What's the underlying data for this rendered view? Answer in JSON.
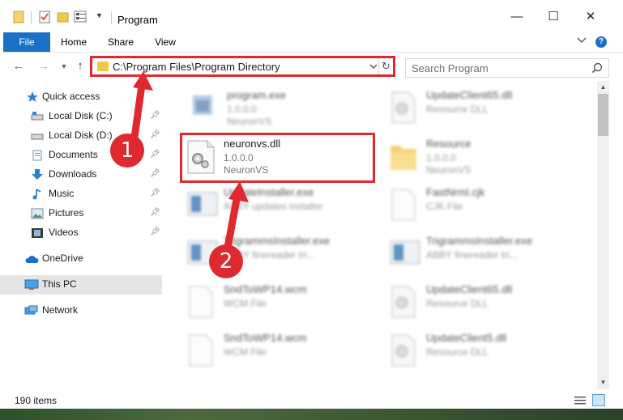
{
  "window": {
    "title": "Program",
    "controls": {
      "minimize": "—",
      "maximize": "☐",
      "close": "✕"
    }
  },
  "ribbon": {
    "tabs": [
      "File",
      "Home",
      "Share",
      "View"
    ],
    "expand_icon": "chevron-down-icon",
    "help": "?"
  },
  "address_bar": {
    "path": "C:\\Program Files\\Program Directory",
    "refresh_icon": "↻"
  },
  "search": {
    "placeholder": "Search Program"
  },
  "sidebar": {
    "items": [
      {
        "label": "Quick access",
        "icon": "star-icon"
      },
      {
        "label": "Local Disk (C:)",
        "icon": "drive-icon",
        "pinned": true
      },
      {
        "label": "Local Disk (D:)",
        "icon": "drive-icon",
        "pinned": true
      },
      {
        "label": "Documents",
        "icon": "documents-icon",
        "pinned": true
      },
      {
        "label": "Downloads",
        "icon": "download-icon",
        "pinned": true
      },
      {
        "label": "Music",
        "icon": "music-icon",
        "pinned": true
      },
      {
        "label": "Pictures",
        "icon": "pictures-icon",
        "pinned": true
      },
      {
        "label": "Videos",
        "icon": "videos-icon",
        "pinned": true
      },
      {
        "label": "OneDrive",
        "icon": "cloud-icon"
      },
      {
        "label": "This PC",
        "icon": "computer-icon",
        "selected": true
      },
      {
        "label": "Network",
        "icon": "network-icon"
      }
    ]
  },
  "files": [
    {
      "name": "program.exe",
      "line2": "1.0.0.0",
      "line3": "NeuronVS",
      "icon": "exe-icon",
      "blurred": true
    },
    {
      "name": "UpdateClient65.dll",
      "line2": "Resource DLL",
      "line3": "",
      "icon": "dll-icon",
      "blurred": true
    },
    {
      "name": "neuronvs.dll",
      "line2": "1.0.0.0",
      "line3": "NeuronVS",
      "icon": "dll-gear-icon",
      "blurred": false
    },
    {
      "name": "Resource",
      "line2": "1.0.0.0",
      "line3": "NeuronVS",
      "icon": "folder-icon",
      "blurred": true
    },
    {
      "name": "UpdateInstaller.exe",
      "line2": "ABBY updates installer",
      "line3": "",
      "icon": "installer-icon",
      "blurred": true
    },
    {
      "name": "FastNrml.cjk",
      "line2": "CJK File",
      "line3": "",
      "icon": "file-icon",
      "blurred": true
    },
    {
      "name": "TrigrammsInstaller.exe",
      "line2": "ABBY finereader tri...",
      "line3": "",
      "icon": "installer-icon",
      "blurred": true
    },
    {
      "name": "TrigrammsInstaller.exe",
      "line2": "ABBY finereader tri...",
      "line3": "",
      "icon": "installer-icon",
      "blurred": true
    },
    {
      "name": "SndToWP14.wcm",
      "line2": "WCM File",
      "line3": "",
      "icon": "file-icon",
      "blurred": true
    },
    {
      "name": "UpdateClient65.dll",
      "line2": "Resource DLL",
      "line3": "",
      "icon": "dll-icon",
      "blurred": true
    },
    {
      "name": "SndToWP14.wcm",
      "line2": "WCM File",
      "line3": "",
      "icon": "file-icon",
      "blurred": true
    },
    {
      "name": "UpdateClient5.dll",
      "line2": "Resource DLL",
      "line3": "",
      "icon": "dll-icon",
      "blurred": true
    }
  ],
  "status": {
    "item_count": "190 items"
  },
  "annotations": {
    "step1": "1",
    "step2": "2",
    "color": "#e0292f"
  }
}
